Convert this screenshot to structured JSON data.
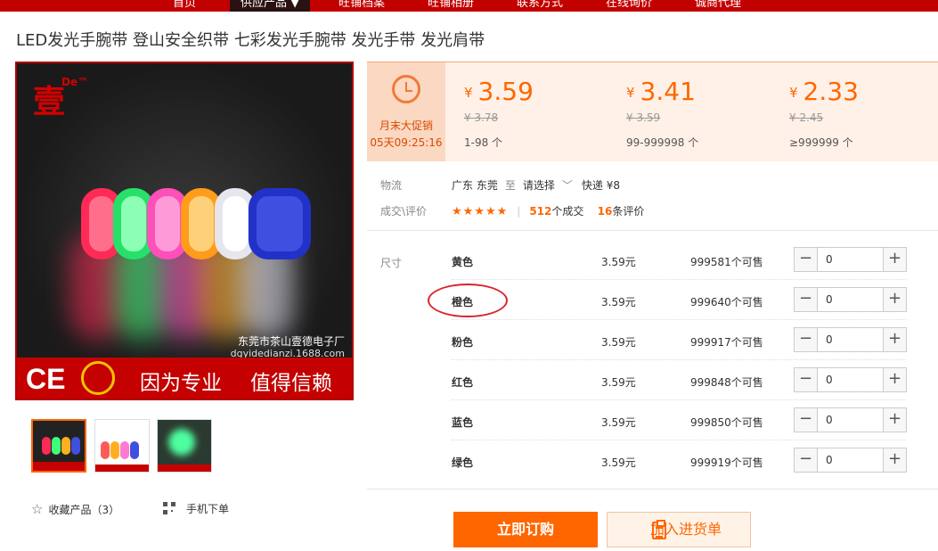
{
  "nav": {
    "items": [
      "首页",
      "供应产品",
      "旺铺档案",
      "旺铺相册",
      "联系方式",
      "在线询价",
      "诚商代理"
    ]
  },
  "product": {
    "title": "LED发光手腕带 登山安全织带 七彩发光手腕带 发光手带 发光肩带"
  },
  "gallery": {
    "logo_text": "壹",
    "logo_sup": "De™",
    "shop_name": "东莞市茶山壹德电子厂",
    "shop_url": "dgyidedianzi.1688.com",
    "ce_mark": "CE",
    "slogan_1": "因为专业",
    "slogan_2": "值得信赖"
  },
  "actions_left": {
    "favorite_label": "收藏产品（3）",
    "mobile_label": "手机下单"
  },
  "promo": {
    "name": "月末大促销",
    "countdown": "05天09:25:16",
    "currency": "¥",
    "tiers": [
      {
        "price": "3.59",
        "original": "¥ 3.78",
        "range": "1-98 个"
      },
      {
        "price": "3.41",
        "original": "¥ 3.59",
        "range": "99-999998 个"
      },
      {
        "price": "2.33",
        "original": "¥ 2.45",
        "range": "≥999999 个"
      }
    ]
  },
  "logistics": {
    "label": "物流",
    "from": "广东 东莞",
    "to_word": "至",
    "destination": "请选择",
    "shipping": "快递 ¥8"
  },
  "deal": {
    "label": "成交\\评价",
    "stars": "★★★★★",
    "deals_count": "512",
    "deals_suffix": "个成交",
    "reviews_count": "16",
    "reviews_suffix": "条评价"
  },
  "sku": {
    "label": "尺寸",
    "rows": [
      {
        "name": "黄色",
        "price": "3.59元",
        "stock": "999581个可售",
        "qty": "0"
      },
      {
        "name": "橙色",
        "price": "3.59元",
        "stock": "999640个可售",
        "qty": "0"
      },
      {
        "name": "粉色",
        "price": "3.59元",
        "stock": "999917个可售",
        "qty": "0"
      },
      {
        "name": "红色",
        "price": "3.59元",
        "stock": "999848个可售",
        "qty": "0"
      },
      {
        "name": "蓝色",
        "price": "3.59元",
        "stock": "999850个可售",
        "qty": "0"
      },
      {
        "name": "绿色",
        "price": "3.59元",
        "stock": "999919个可售",
        "qty": "0"
      }
    ]
  },
  "buttons": {
    "buy": "立即订购",
    "cart": "加入进货单"
  },
  "colors": {
    "accent": "#ff6600",
    "nav_bg": "#c30000",
    "promo_bg": "#fff1e7",
    "highlight_circle": "#d9262e"
  }
}
